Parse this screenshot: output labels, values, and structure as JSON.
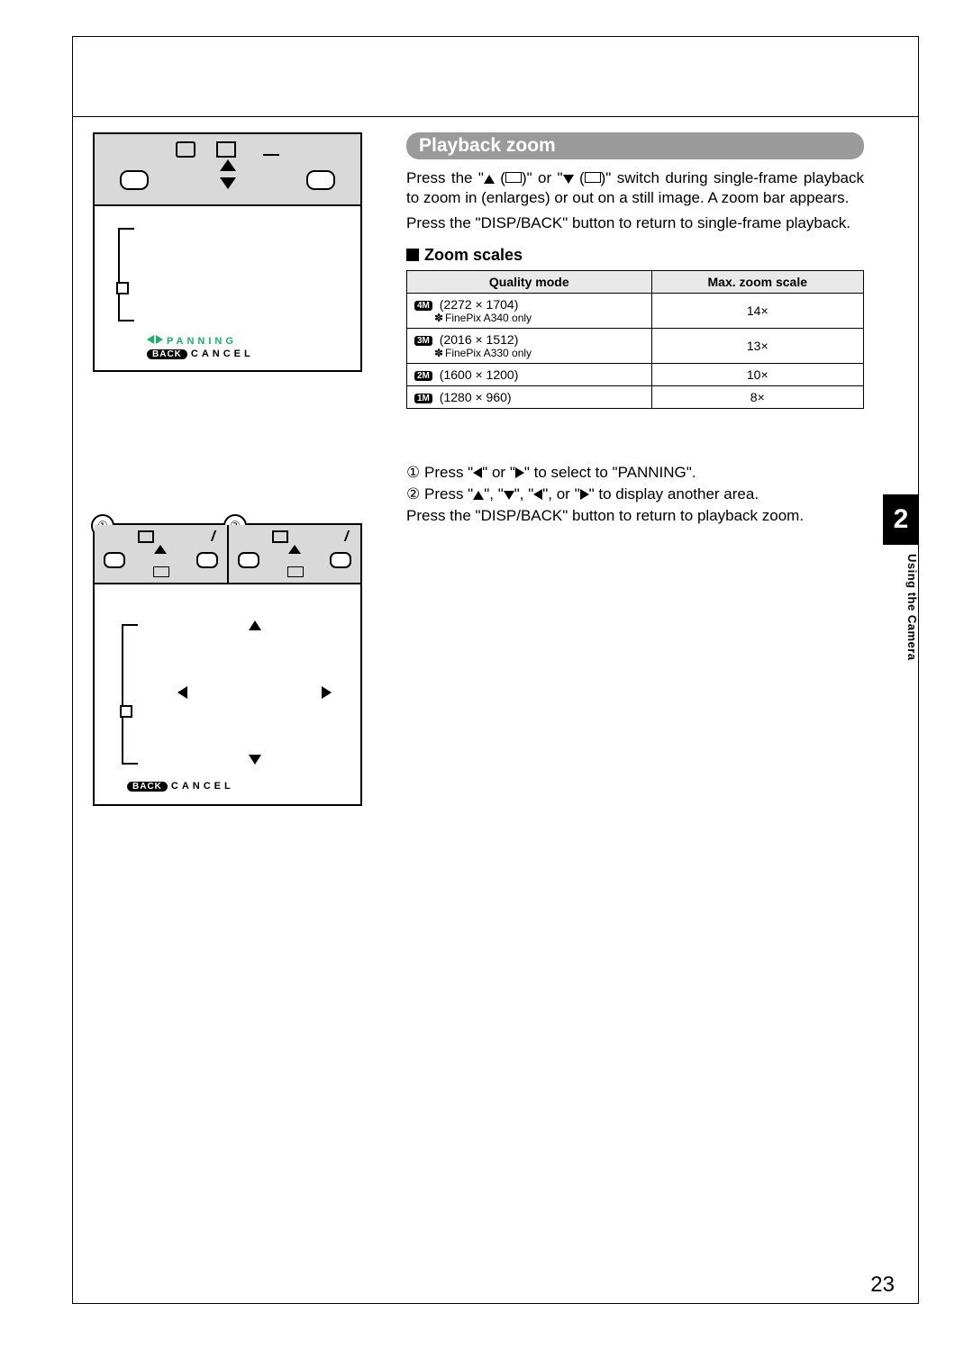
{
  "section_heading": "Playback zoom",
  "para1_pre": "Press the \"",
  "para1_mid1": " (",
  "para1_mid2": ")\" or \"",
  "para1_mid3": " (",
  "para1_mid4": ")\" switch during single-frame playback to zoom in (enlarges) or out on a still image. A zoom bar appears.",
  "para2": "Press the \"DISP/BACK\" button to return to single-frame playback.",
  "sub_heading": "Zoom scales",
  "table": {
    "head_quality": "Quality mode",
    "head_max": "Max. zoom scale",
    "rows": [
      {
        "badge": "4M",
        "res": "(2272 × 1704)",
        "note": "FinePix A340 only",
        "scale": "14×"
      },
      {
        "badge": "3M",
        "res": "(2016 × 1512)",
        "note": "FinePix A330 only",
        "scale": "13×"
      },
      {
        "badge": "2M",
        "res": "(1600 × 1200)",
        "note": "",
        "scale": "10×"
      },
      {
        "badge": "1M",
        "res": "(1280 × 960)",
        "note": "",
        "scale": "8×"
      }
    ]
  },
  "steps": {
    "n1": "①",
    "t1_pre": "Press \"",
    "t1_mid": "\" or \"",
    "t1_post": "\" to select to \"PANNING\".",
    "n2": "②",
    "t2_pre": "Press \"",
    "t2_sep": "\", \"",
    "t2_or": "\", or \"",
    "t2_post": "\" to display another area.",
    "after": "Press the \"DISP/BACK\" button to return to playback zoom."
  },
  "ill": {
    "panning": "PANNING",
    "cancel": "CANCEL",
    "back": "BACK"
  },
  "side": {
    "chapter_num": "2",
    "chapter_label": "Using the Camera"
  },
  "page_number": "23",
  "note_prefix": "✽"
}
